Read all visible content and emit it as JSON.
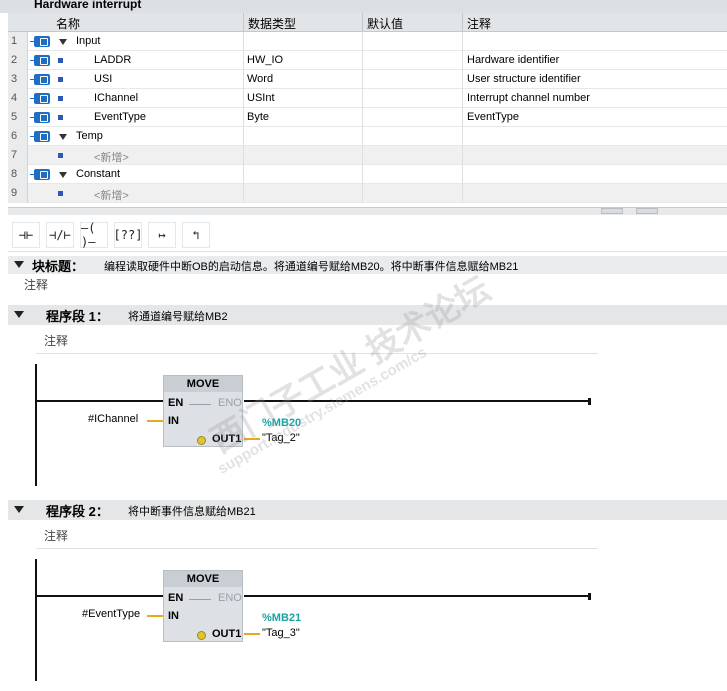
{
  "block_name": "Hardware interrupt",
  "table": {
    "headers": [
      "名称",
      "数据类型",
      "默认值",
      "注释"
    ],
    "rows": [
      {
        "num": "1",
        "name": "Input",
        "type": "",
        "default": "",
        "comment": "",
        "kind": "section"
      },
      {
        "num": "2",
        "name": "LADDR",
        "type": "HW_IO",
        "default": "",
        "comment": "Hardware identifier",
        "kind": "item"
      },
      {
        "num": "3",
        "name": "USI",
        "type": "Word",
        "default": "",
        "comment": "User structure identifier",
        "kind": "item"
      },
      {
        "num": "4",
        "name": "IChannel",
        "type": "USInt",
        "default": "",
        "comment": "Interrupt channel number",
        "kind": "item"
      },
      {
        "num": "5",
        "name": "EventType",
        "type": "Byte",
        "default": "",
        "comment": "EventType",
        "kind": "item"
      },
      {
        "num": "6",
        "name": "Temp",
        "type": "",
        "default": "",
        "comment": "",
        "kind": "section"
      },
      {
        "num": "7",
        "name": "<新增>",
        "type": "",
        "default": "",
        "comment": "",
        "kind": "add"
      },
      {
        "num": "8",
        "name": "Constant",
        "type": "",
        "default": "",
        "comment": "",
        "kind": "section"
      },
      {
        "num": "9",
        "name": "<新增>",
        "type": "",
        "default": "",
        "comment": "",
        "kind": "add"
      }
    ]
  },
  "toolbar": {
    "buttons": [
      {
        "name": "no-contact",
        "glyph": "⊣⊢"
      },
      {
        "name": "nc-contact",
        "glyph": "⊣/⊢"
      },
      {
        "name": "coil",
        "glyph": "–( )–"
      },
      {
        "name": "empty-box",
        "glyph": "[??]"
      },
      {
        "name": "open-branch",
        "glyph": "↦"
      },
      {
        "name": "close-branch",
        "glyph": "↰"
      }
    ]
  },
  "block_title": {
    "label": "块标题：",
    "description": "编程读取硬件中断OB的启动信息。将通道编号赋给MB20。将中断事件信息赋给MB21",
    "comment": "注释"
  },
  "networks": [
    {
      "label": "程序段 1：",
      "description": "将通道编号赋给MB2",
      "comment": "注释",
      "box": {
        "title": "MOVE",
        "en": "EN",
        "eno": "ENO",
        "in": "IN",
        "out": "OUT1"
      },
      "input_param": "#IChannel",
      "output_addr": "%MB20",
      "output_tag": "\"Tag_2\""
    },
    {
      "label": "程序段 2：",
      "description": "将中断事件信息赋给MB21",
      "comment": "注释",
      "box": {
        "title": "MOVE",
        "en": "EN",
        "eno": "ENO",
        "in": "IN",
        "out": "OUT1"
      },
      "input_param": "#EventType",
      "output_addr": "%MB21",
      "output_tag": "\"Tag_3\""
    }
  ],
  "watermark": {
    "text1": "西门子工业 技术论坛",
    "text2": "support.industry.siemens.com/cs"
  }
}
